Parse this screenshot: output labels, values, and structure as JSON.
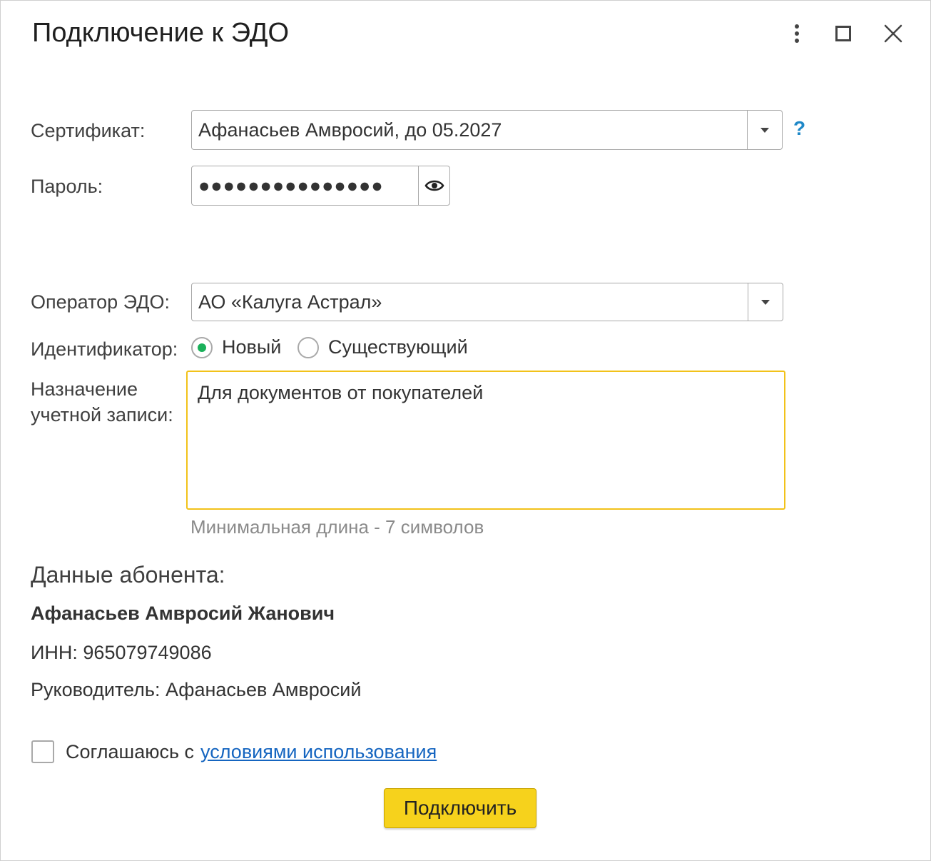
{
  "window": {
    "title": "Подключение к ЭДО",
    "buttons": {
      "menu": "more-vertical-icon",
      "maximize": "maximize-icon",
      "close": "close-icon"
    }
  },
  "form": {
    "certificate": {
      "label": "Сертификат:",
      "value": "Афанасьев Амвросий, до 05.2027",
      "help": "?"
    },
    "password": {
      "label": "Пароль:",
      "masked_value": "●●●●●●●●●●●●●●●"
    },
    "operator": {
      "label": "Оператор ЭДО:",
      "value": "АО «Калуга Астрал»"
    },
    "identifier": {
      "label": "Идентификатор:",
      "options": [
        {
          "label": "Новый",
          "selected": true
        },
        {
          "label": "Существующий",
          "selected": false
        }
      ]
    },
    "purpose": {
      "label_line1": "Назначение",
      "label_line2": "учетной записи:",
      "value": "Для документов от покупателей",
      "hint": "Минимальная длина - 7 символов"
    }
  },
  "subscriber": {
    "heading": "Данные абонента:",
    "name": "Афанасьев Амвросий Жанович",
    "inn": "ИНН: 965079749086",
    "head": "Руководитель: Афанасьев Амвросий"
  },
  "agreement": {
    "checked": false,
    "text": "Соглашаюсь с",
    "link": "условиями использования"
  },
  "actions": {
    "connect_label": "Подключить"
  },
  "colors": {
    "accent_button": "#f6d21c",
    "focus_border": "#f2c21a",
    "radio_selected": "#1ab05a",
    "link": "#1565c0",
    "help": "#1e88c8"
  }
}
